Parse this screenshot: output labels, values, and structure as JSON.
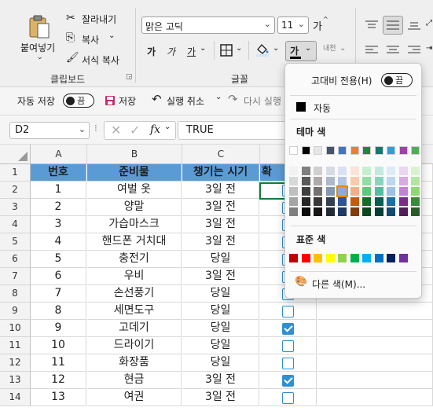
{
  "clipboard": {
    "paste_label": "붙여넣기",
    "cut_label": "잘라내기",
    "copy_label": "복사",
    "format_painter_label": "서식 복사",
    "group_label": "클립보드"
  },
  "font": {
    "name": "맑은 고딕",
    "size": "11",
    "grow_label": "가",
    "bold_label": "가",
    "italic_label": "가",
    "underline_label": "가",
    "font_color_label": "가",
    "phonetic_label": "내천",
    "group_label": "글꼴"
  },
  "qat": {
    "autosave_label": "자동 저장",
    "toggle_off": "끔",
    "save_label": "저장",
    "undo_label": "실행 취소",
    "redo_label": "다시 실행"
  },
  "formula_bar": {
    "name_box": "D2",
    "fx_label": "fx",
    "value": "TRUE"
  },
  "sheet": {
    "columns": [
      "A",
      "B",
      "C"
    ],
    "header_row": [
      "번호",
      "준비물",
      "챙기는 시기",
      "확"
    ],
    "rows": [
      {
        "num": "1",
        "no": "1",
        "item": "여벌 옷",
        "when": "3일 전",
        "checked": false
      },
      {
        "num": "2",
        "no": "2",
        "item": "양말",
        "when": "3일 전",
        "checked": false
      },
      {
        "num": "3",
        "no": "3",
        "item": "가습마스크",
        "when": "3일 전",
        "checked": false
      },
      {
        "num": "4",
        "no": "4",
        "item": "핸드폰 거치대",
        "when": "3일 전",
        "checked": false
      },
      {
        "num": "5",
        "no": "5",
        "item": "충전기",
        "when": "당일",
        "checked": false
      },
      {
        "num": "6",
        "no": "6",
        "item": "우비",
        "when": "3일 전",
        "checked": false
      },
      {
        "num": "7",
        "no": "7",
        "item": "손선풍기",
        "when": "당일",
        "checked": false
      },
      {
        "num": "8",
        "no": "8",
        "item": "세면도구",
        "when": "당일",
        "checked": false
      },
      {
        "num": "9",
        "no": "9",
        "item": "고데기",
        "when": "당일",
        "checked": true
      },
      {
        "num": "10",
        "no": "10",
        "item": "드라이기",
        "when": "당일",
        "checked": false
      },
      {
        "num": "11",
        "no": "11",
        "item": "화장품",
        "when": "당일",
        "checked": false
      },
      {
        "num": "12",
        "no": "12",
        "item": "현금",
        "when": "3일 전",
        "checked": true
      },
      {
        "num": "13",
        "no": "13",
        "item": "여권",
        "when": "3일 전",
        "checked": false
      }
    ],
    "header_row_number": "1",
    "row_numbers": [
      "1",
      "2",
      "3",
      "4",
      "5",
      "6",
      "7",
      "8",
      "9",
      "10",
      "11",
      "12",
      "13",
      "14"
    ]
  },
  "color_menu": {
    "high_contrast_label": "고대비 전용(H)",
    "high_contrast_toggle": "끔",
    "automatic_label": "자동",
    "theme_label": "테마 색",
    "standard_label": "표준 색",
    "more_colors_label": "다른 색(M)...",
    "theme_top": [
      "#ffffff",
      "#000000",
      "#e7e6e6",
      "#44546a",
      "#4472c4",
      "#ed7d31",
      "#1b8a3b",
      "#0f7a6e",
      "#2e9ed6",
      "#a33cb0",
      "#4caf50"
    ],
    "theme_shades": [
      [
        "#f2f2f2",
        "#7f7f7f",
        "#d0cece",
        "#d6dce4",
        "#d9e1f2",
        "#fbe4d5",
        "#c6efce",
        "#c4eadf",
        "#ddebf7",
        "#ecd5f1",
        "#d9f2d0"
      ],
      [
        "#d8d8d8",
        "#595959",
        "#aeaaaa",
        "#adb9ca",
        "#b4c6e7",
        "#f8cbad",
        "#94dba6",
        "#8ad4be",
        "#bdd7ee",
        "#d8abe3",
        "#b3e5a1"
      ],
      [
        "#bfbfbf",
        "#3f3f3f",
        "#757171",
        "#8497b0",
        "#8ea9db",
        "#f4b084",
        "#5cc97b",
        "#50bfa0",
        "#9bc2e6",
        "#c581d4",
        "#8ed873"
      ],
      [
        "#a5a5a5",
        "#262626",
        "#3a3838",
        "#333f4f",
        "#2f5597",
        "#c65911",
        "#146b2d",
        "#0b5b52",
        "#1f6fa6",
        "#7a2d84",
        "#3a8a3c"
      ],
      [
        "#7f7f7f",
        "#0c0c0c",
        "#171616",
        "#222a35",
        "#1f3864",
        "#833c0b",
        "#0d4720",
        "#073d37",
        "#134a70",
        "#511e58",
        "#275c28"
      ]
    ],
    "standard": [
      "#c00000",
      "#ff0000",
      "#ffc000",
      "#ffff00",
      "#92d050",
      "#00b050",
      "#00b0f0",
      "#0070c0",
      "#002060",
      "#7030a0"
    ],
    "selected_shade": "#2f6fb5"
  }
}
